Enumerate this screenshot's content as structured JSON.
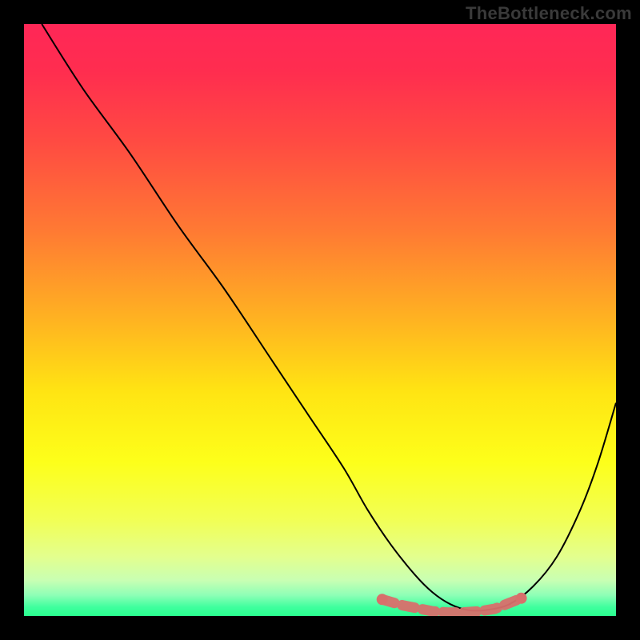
{
  "watermark": "TheBottleneck.com",
  "colors": {
    "background": "#000000",
    "curve": "#000000",
    "marker": "#d86f6b",
    "gradient_stops": [
      {
        "offset": 0.0,
        "color": "#ff2757"
      },
      {
        "offset": 0.08,
        "color": "#ff2d4f"
      },
      {
        "offset": 0.2,
        "color": "#ff4b42"
      },
      {
        "offset": 0.35,
        "color": "#ff7a33"
      },
      {
        "offset": 0.5,
        "color": "#ffb321"
      },
      {
        "offset": 0.62,
        "color": "#ffe413"
      },
      {
        "offset": 0.74,
        "color": "#fdff1a"
      },
      {
        "offset": 0.84,
        "color": "#f1ff57"
      },
      {
        "offset": 0.9,
        "color": "#e3ff8e"
      },
      {
        "offset": 0.94,
        "color": "#c8ffb3"
      },
      {
        "offset": 0.965,
        "color": "#8dffb6"
      },
      {
        "offset": 0.985,
        "color": "#3fff9e"
      },
      {
        "offset": 1.0,
        "color": "#2aff8f"
      }
    ]
  },
  "chart_data": {
    "type": "line",
    "title": "",
    "xlabel": "",
    "ylabel": "",
    "xlim": [
      0,
      100
    ],
    "ylim": [
      0,
      100
    ],
    "series": [
      {
        "name": "bottleneck-curve",
        "x": [
          3,
          10,
          18,
          26,
          34,
          42,
          48,
          54,
          58,
          62,
          66,
          69,
          72,
          75,
          78,
          82,
          86,
          90,
          94,
          97,
          100
        ],
        "y": [
          100,
          89,
          78,
          66,
          55,
          43,
          34,
          25,
          18,
          12,
          7,
          4,
          2,
          1,
          1,
          2,
          5,
          10,
          18,
          26,
          36
        ]
      }
    ],
    "markers": {
      "name": "highlight-points",
      "x": [
        60.5,
        64,
        67,
        69,
        71.5,
        74,
        77,
        79.5,
        81.5,
        84
      ],
      "y": [
        2.8,
        1.8,
        1.2,
        0.8,
        0.6,
        0.6,
        0.8,
        1.2,
        2.0,
        3.0
      ]
    }
  }
}
